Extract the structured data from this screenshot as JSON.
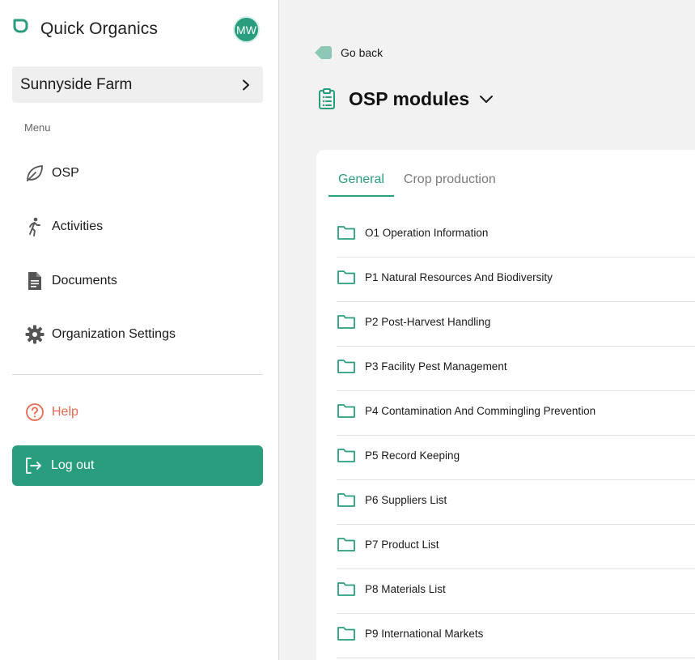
{
  "app": {
    "name": "Quick Organics",
    "avatar_initials": "MW"
  },
  "farm": {
    "name": "Sunnyside Farm"
  },
  "sidebar": {
    "menu_label": "Menu",
    "items": [
      {
        "label": "OSP",
        "icon": "leaf-icon"
      },
      {
        "label": "Activities",
        "icon": "person-walking-icon"
      },
      {
        "label": "Documents",
        "icon": "document-icon"
      },
      {
        "label": "Organization Settings",
        "icon": "gear-icon"
      }
    ],
    "help_label": "Help",
    "logout_label": "Log out"
  },
  "main": {
    "back_label": "Go back",
    "title": "OSP modules",
    "tabs": [
      {
        "label": "General",
        "active": true
      },
      {
        "label": "Crop production",
        "active": false
      }
    ],
    "modules": [
      "O1 Operation Information",
      "P1 Natural Resources And Biodiversity",
      "P2 Post-Harvest Handling",
      "P3 Facility Pest Management",
      "P4 Contamination And Commingling Prevention",
      "P5 Record Keeping",
      "P6 Suppliers List",
      "P7 Product List",
      "P8 Materials List",
      "P9 International Markets"
    ]
  },
  "colors": {
    "accent": "#2a9d7e",
    "help": "#e86a50",
    "back_icon": "#8cc7b8"
  }
}
